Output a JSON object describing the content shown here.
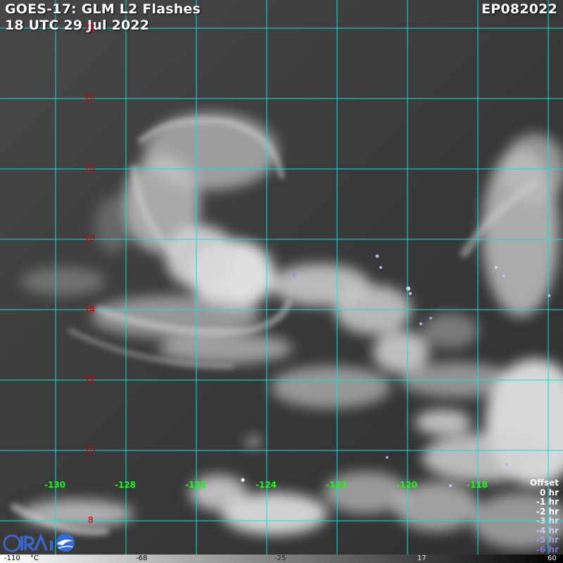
{
  "header": {
    "title": "GOES-17: GLM L2 Flashes",
    "time": "18 UTC 29 Jul 2022",
    "storm_id": "EP082022"
  },
  "lat_labels": [
    "22",
    "20",
    "18",
    "16",
    "14",
    "12",
    "10",
    "8"
  ],
  "lon_labels": [
    "-130",
    "-128",
    "-126",
    "-124",
    "-122",
    "-120",
    "-118"
  ],
  "offset_legend": {
    "title": "Offset",
    "items": [
      {
        "label": "0 hr",
        "color": "#ffffff"
      },
      {
        "label": "-1 hr",
        "color": "#ffffff"
      },
      {
        "label": "-2 hr",
        "color": "#ffffff"
      },
      {
        "label": "-3 hr",
        "color": "#d8d8f4"
      },
      {
        "label": "-4 hr",
        "color": "#c8c8f0"
      },
      {
        "label": "-5 hr",
        "color": "#a8a0e0"
      },
      {
        "label": "-6 hr",
        "color": "#8a70d0"
      }
    ]
  },
  "colorbar": {
    "ticks": [
      "-110",
      "°C",
      "-68",
      "-25",
      "17",
      "60"
    ]
  },
  "colors": {
    "grid": "#00e5e5",
    "lat_label": "#d00000",
    "lon_label": "#11ff11"
  }
}
